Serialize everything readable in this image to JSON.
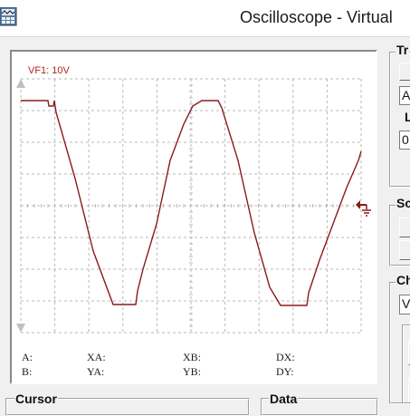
{
  "window": {
    "title": "Oscilloscope - Virtual",
    "icon": "oscilloscope-app-icon"
  },
  "scope": {
    "channel_label": "VF1: 10V",
    "trace_color": "#8b1a1a",
    "label_color": "#b22222",
    "screen_color": "#ffffff",
    "grid_color": "#b8b8b8",
    "marker_color": "#8b1a1a",
    "ground_marker_icon": "ground-marker-icon",
    "trigger_marker_icon": "trigger-arrow-icon"
  },
  "readouts": {
    "a": "A:",
    "b": "B:",
    "xa": "XA:",
    "ya": "YA:",
    "xb": "XB:",
    "yb": "YB:",
    "dx": "DX:",
    "dy": "DY:"
  },
  "right_panel": {
    "trigger_group_label": "Tr",
    "trigger_mode_value": "A",
    "trigger_level_label": "L",
    "trigger_level_value": "0",
    "scale_group_label": "Sc",
    "channel_group_label": "Ch",
    "channel_value": "V"
  },
  "bottom": {
    "cursor_group_label": "Cursor",
    "data_group_label": "Data"
  }
}
